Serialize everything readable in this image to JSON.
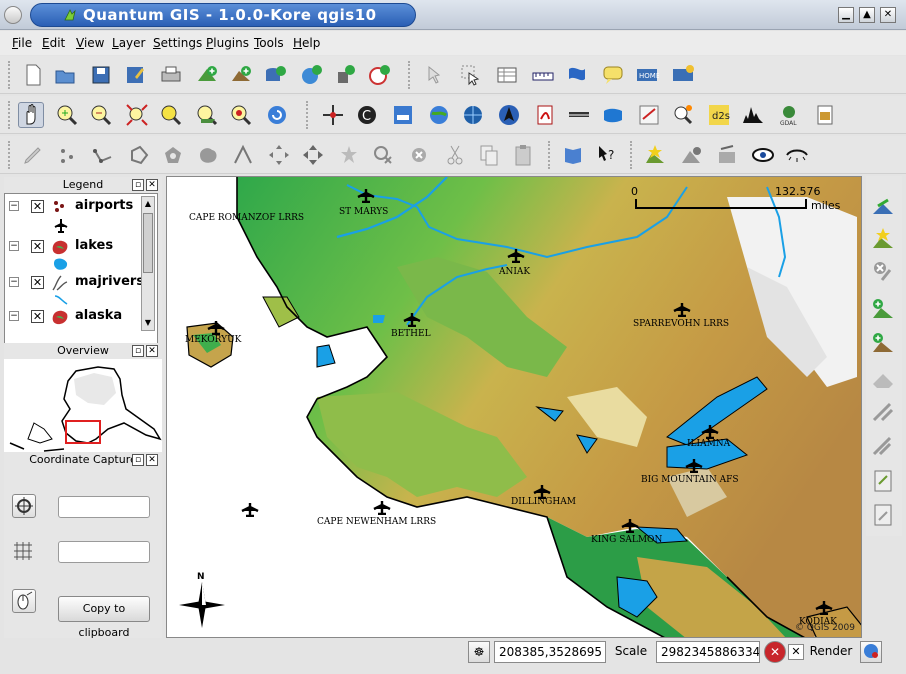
{
  "window": {
    "title": "Quantum GIS - 1.0.0-Kore  qgis10"
  },
  "menu": [
    "File",
    "Edit",
    "View",
    "Layer",
    "Settings",
    "Plugins",
    "Tools",
    "Help"
  ],
  "toolbar1": [
    "new-project-icon",
    "open-project-icon",
    "save-project-icon",
    "save-as-icon",
    "print-icon",
    "add-raster-icon",
    "add-vector-icon",
    "add-postgis-icon",
    "add-wms-icon",
    "add-spatialite-icon",
    "add-gps-icon",
    "identify-icon",
    "select-icon",
    "attribute-table-icon",
    "measure-line-icon",
    "measure-area-icon",
    "map-tips-icon",
    "home-bookmark-icon",
    "new-bookmark-icon"
  ],
  "toolbar2": [
    "pan-icon",
    "zoom-in-icon",
    "zoom-out-icon",
    "zoom-full-icon",
    "zoom-selection-icon",
    "zoom-layer-icon",
    "zoom-last-icon",
    "refresh-icon",
    "capture-coordinate-icon",
    "copyright-icon",
    "scalebar-plugin-icon",
    "wfs-icon",
    "georeferencer-icon",
    "north-arrow-icon",
    "pdf-icon",
    "scale-icon",
    "delimited-text-icon",
    "grid-maker-icon",
    "spit-icon",
    "dxf-icon",
    "histogram-icon",
    "gdal-tools-icon",
    "export-icon"
  ],
  "toolbar3": [
    "edit-pencil-icon",
    "capture-point-icon",
    "capture-line-icon",
    "capture-polygon-icon",
    "add-ring-icon",
    "add-island-icon",
    "split-features-icon",
    "move-vertex-icon",
    "move-feature-icon",
    "add-vertex-icon",
    "delete-vertex-icon",
    "delete-selected-icon",
    "cut-features-icon",
    "copy-features-icon",
    "paste-features-icon",
    "help-book-icon",
    "whats-this-icon",
    "new-vector-icon",
    "remove-layer-icon",
    "toggle-layers-icon",
    "show-all-icon",
    "hide-all-icon"
  ],
  "legend": {
    "title": "Legend",
    "layers": [
      {
        "name": "airports",
        "checked": "✕"
      },
      {
        "name": "lakes",
        "checked": "✕"
      },
      {
        "name": "majrivers",
        "checked": "✕"
      },
      {
        "name": "alaska",
        "checked": "✕"
      }
    ]
  },
  "overview": {
    "title": "Overview"
  },
  "coord_capture": {
    "title": "Coordinate Capture",
    "field1": "",
    "field2": "",
    "copy_label": "Copy to clipboard"
  },
  "map": {
    "cities": [
      "CAPE ROMANZOF LRRS",
      "ST MARYS",
      "ANIAK",
      "SPARREVOHN LRRS",
      "MEKORYUK",
      "BETHEL",
      "ILIAMNA",
      "BIG MOUNTAIN AFS",
      "DILLINGHAM",
      "CAPE NEWENHAM LRRS",
      "KING SALMON",
      "KODIAK"
    ],
    "scale_zero": "0",
    "scale_value": "132.576",
    "scale_unit": "miles",
    "north_label": "N",
    "copyright": "© QGIS 2009",
    "colors": {
      "water": "#1aa0e6",
      "lowland": "#3fae4c",
      "upland": "#c6a84a",
      "peaks": "#ffffff"
    }
  },
  "right_toolbar": [
    "add-vector-layer-icon",
    "new-layer-icon",
    "remove-icon",
    "add-raster-icon",
    "add-feature-icon",
    "edit-icon",
    "node-icon",
    "split-icon",
    "doc-icon",
    "doc2-icon"
  ],
  "status": {
    "coords": "208385,3528695",
    "scale_label": "Scale",
    "scale_value": "2982345886334",
    "render_label": "Render",
    "render_checked": "✕"
  }
}
